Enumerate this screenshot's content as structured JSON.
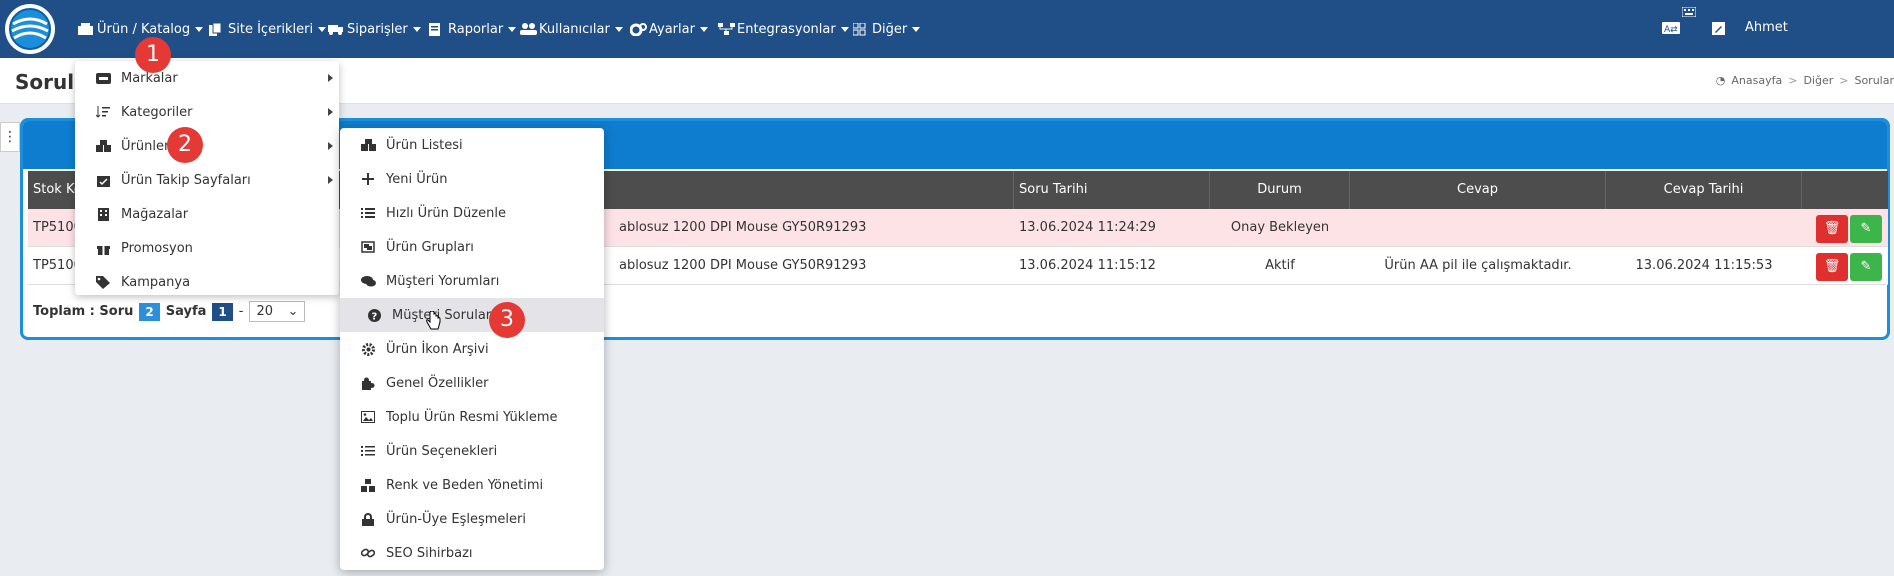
{
  "nav": {
    "items": [
      {
        "label": "Ürün / Katalog",
        "icon": "boxes-icon"
      },
      {
        "label": "Site İçerikleri",
        "icon": "copy-icon"
      },
      {
        "label": "Siparişler",
        "icon": "truck-icon"
      },
      {
        "label": "Raporlar",
        "icon": "report-icon"
      },
      {
        "label": "Kullanıcılar",
        "icon": "users-icon"
      },
      {
        "label": "Ayarlar",
        "icon": "gears-icon"
      },
      {
        "label": "Entegrasyonlar",
        "icon": "sitemap-icon"
      },
      {
        "label": "Diğer",
        "icon": "grid-icon"
      }
    ],
    "user": "Ahmet"
  },
  "page": {
    "title": "Sorular",
    "breadcrumb": [
      "Anasayfa",
      "Diğer",
      "Sorular"
    ]
  },
  "menu1": [
    {
      "label": "Markalar",
      "icon": "id-card-icon",
      "submenu": true
    },
    {
      "label": "Kategoriler",
      "icon": "sort-list-icon",
      "submenu": true
    },
    {
      "label": "Ürünler",
      "icon": "cubes-icon",
      "submenu": true
    },
    {
      "label": "Ürün Takip Sayfaları",
      "icon": "calendar-check-icon",
      "submenu": true
    },
    {
      "label": "Mağazalar",
      "icon": "building-icon",
      "submenu": false
    },
    {
      "label": "Promosyon",
      "icon": "gift-icon",
      "submenu": false
    },
    {
      "label": "Kampanya",
      "icon": "tags-icon",
      "submenu": false
    }
  ],
  "menu2": [
    {
      "label": "Ürün Listesi",
      "icon": "cubes-icon"
    },
    {
      "label": "Yeni Ürün",
      "icon": "plus-icon"
    },
    {
      "label": "Hızlı Ürün Düzenle",
      "icon": "list-icon"
    },
    {
      "label": "Ürün Grupları",
      "icon": "object-group-icon"
    },
    {
      "label": "Müşteri Yorumları",
      "icon": "comments-icon"
    },
    {
      "label": "Müşteri Soruları",
      "icon": "question-circle-icon"
    },
    {
      "label": "Ürün İkon Arşivi",
      "icon": "cog-icon"
    },
    {
      "label": "Genel Özellikler",
      "icon": "puzzle-icon"
    },
    {
      "label": "Toplu Ürün Resmi Yükleme",
      "icon": "image-icon"
    },
    {
      "label": "Ürün Seçenekleri",
      "icon": "list-ol-icon"
    },
    {
      "label": "Renk ve Beden Yönetimi",
      "icon": "cubes-stack-icon"
    },
    {
      "label": "Ürün-Üye Eşleşmeleri",
      "icon": "lock-icon"
    },
    {
      "label": "SEO Sihirbazı",
      "icon": "link-icon"
    }
  ],
  "table": {
    "headers": {
      "stok": "Stok Ko",
      "soru_tarihi": "Soru Tarihi",
      "durum": "Durum",
      "cevap": "Cevap",
      "cevap_tarihi": "Cevap Tarihi"
    },
    "rows": [
      {
        "stok": "TP5100",
        "urun": "ablosuz 1200 DPI Mouse GY50R91293",
        "soru_tarihi": "13.06.2024 11:24:29",
        "durum": "Onay Bekleyen",
        "cevap": "",
        "cevap_tarihi": ""
      },
      {
        "stok": "TP5100",
        "urun": "ablosuz 1200 DPI Mouse GY50R91293",
        "soru_tarihi": "13.06.2024 11:15:12",
        "durum": "Aktif",
        "cevap": "Ürün AA pil ile çalışmaktadır.",
        "cevap_tarihi": "13.06.2024 11:15:53"
      }
    ]
  },
  "footer": {
    "toplam_label": "Toplam : Soru",
    "toplam_value": "2",
    "sayfa_label": "Sayfa",
    "sayfa_value": "1",
    "dash": "-",
    "page_size": "20"
  },
  "steps": [
    "1",
    "2",
    "3"
  ]
}
